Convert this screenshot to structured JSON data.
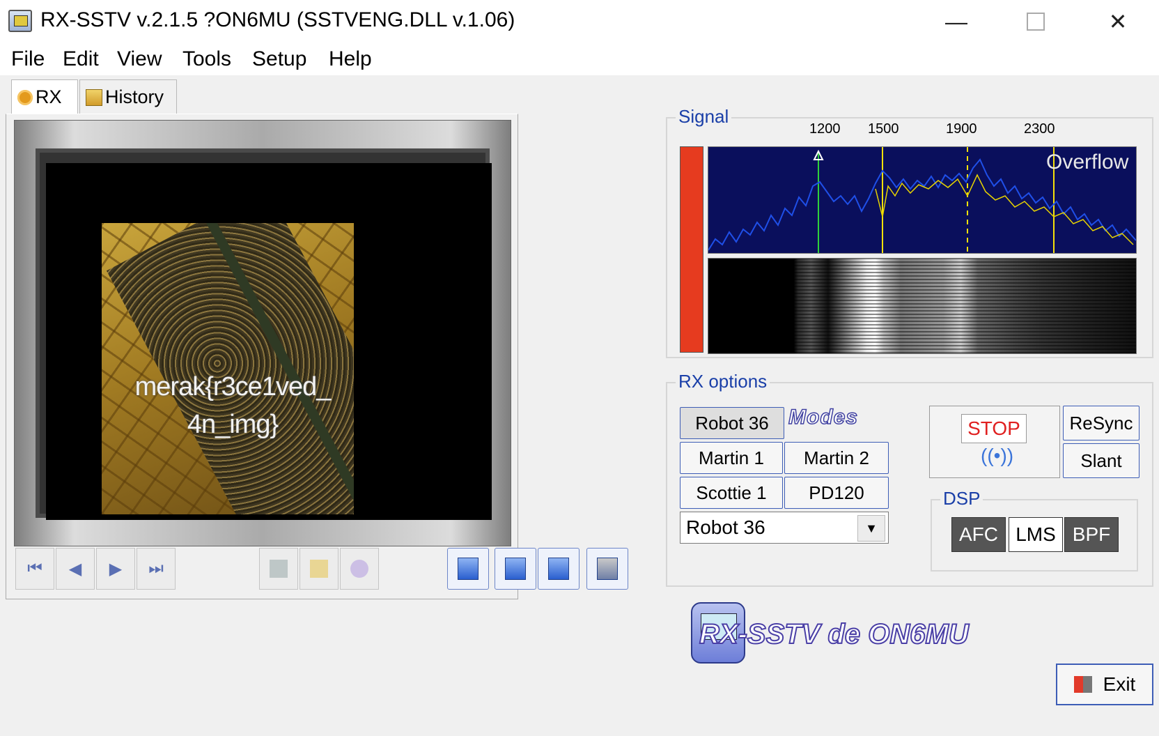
{
  "window": {
    "title": "RX-SSTV v.2.1.5 ?ON6MU (SSTVENG.DLL v.1.06)"
  },
  "menu": {
    "items": [
      "File",
      "Edit",
      "View",
      "Tools",
      "Setup",
      "Help"
    ]
  },
  "tabs": [
    {
      "label": "RX",
      "icon": "gear-icon",
      "active": true
    },
    {
      "label": "History",
      "icon": "history-icon",
      "active": false
    }
  ],
  "image": {
    "overlay_text_line1": "merak{r3ce1ved_",
    "overlay_text_line2": "4n_img}"
  },
  "signal": {
    "title": "Signal",
    "freq_labels": [
      "1200",
      "1500",
      "1900",
      "2300"
    ],
    "overflow_label": "Overflow"
  },
  "rx_options": {
    "title": "RX options",
    "modes_logo": "Modes",
    "buttons": {
      "robot36": "Robot 36",
      "martin1": "Martin 1",
      "martin2": "Martin 2",
      "scottie1": "Scottie 1",
      "pd120": "PD120"
    },
    "selected_mode": "Robot 36",
    "stop": "STOP",
    "resync": "ReSync",
    "slant": "Slant"
  },
  "dsp": {
    "title": "DSP",
    "afc": "AFC",
    "lms": "LMS",
    "bpf": "BPF"
  },
  "brand": "RX-SSTV de ON6MU",
  "exit": "Exit",
  "colors": {
    "accent": "#1a3fa8",
    "spectrum_bg": "#0a0f5c",
    "signal_bar": "#e63b1f",
    "stop_text": "#e02020"
  }
}
